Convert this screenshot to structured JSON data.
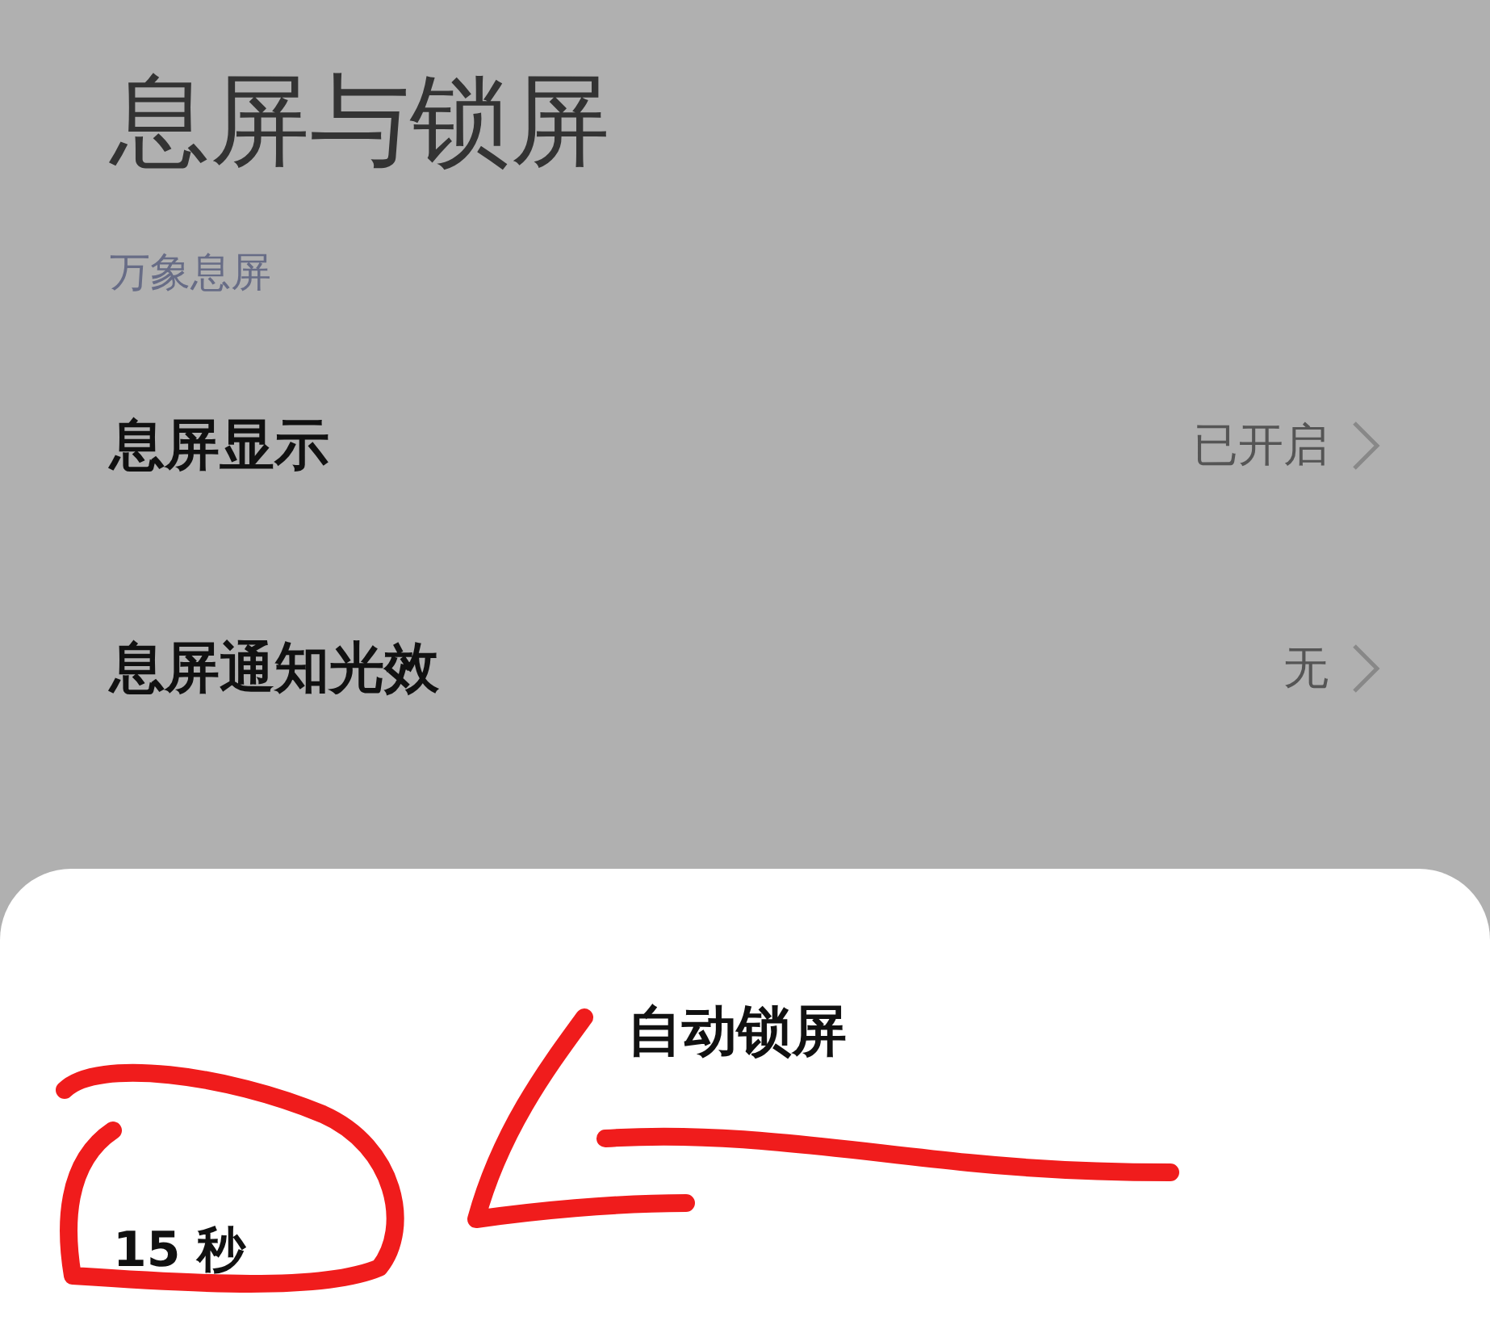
{
  "page": {
    "title": "息屏与锁屏"
  },
  "section": {
    "label": "万象息屏"
  },
  "rows": [
    {
      "label": "息屏显示",
      "value": "已开启"
    },
    {
      "label": "息屏通知光效",
      "value": "无"
    }
  ],
  "sheet": {
    "title": "自动锁屏",
    "options": [
      {
        "label": "15 秒"
      }
    ]
  }
}
